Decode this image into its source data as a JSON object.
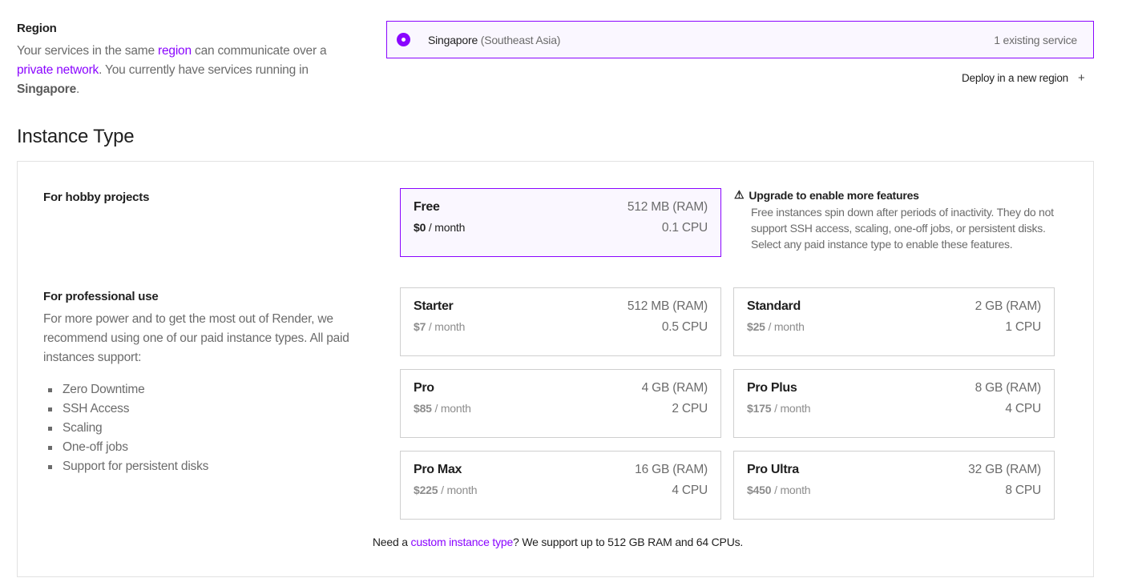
{
  "region": {
    "title": "Region",
    "desc_pre": "Your services in the same ",
    "desc_link1": "region",
    "desc_mid": " can communicate over a ",
    "desc_link2": "private network",
    "desc_post": ". You currently have services running in ",
    "desc_bold": "Singapore",
    "desc_end": ".",
    "option": {
      "name": "Singapore",
      "sub": "(Southeast Asia)",
      "count": "1 existing service"
    },
    "deploy_new_label": "Deploy in a new region"
  },
  "instance": {
    "title": "Instance Type",
    "hobby_title": "For hobby projects",
    "pro_title": "For professional use",
    "pro_desc": "For more power and to get the most out of Render, we recommend using one of our paid instance types. All paid instances support:",
    "features": [
      "Zero Downtime",
      "SSH Access",
      "Scaling",
      "One-off jobs",
      "Support for persistent disks"
    ],
    "per_month": "/ month",
    "free": {
      "name": "Free",
      "ram": "512 MB (RAM)",
      "price": "$0",
      "cpu": "0.1 CPU"
    },
    "warning": {
      "title": "Upgrade to enable more features",
      "body": "Free instances spin down after periods of inactivity. They do not support SSH access, scaling, one-off jobs, or persistent disks. Select any paid instance type to enable these features."
    },
    "plans": [
      {
        "name": "Starter",
        "ram": "512 MB (RAM)",
        "price": "$7",
        "cpu": "0.5 CPU"
      },
      {
        "name": "Standard",
        "ram": "2 GB (RAM)",
        "price": "$25",
        "cpu": "1 CPU"
      },
      {
        "name": "Pro",
        "ram": "4 GB (RAM)",
        "price": "$85",
        "cpu": "2 CPU"
      },
      {
        "name": "Pro Plus",
        "ram": "8 GB (RAM)",
        "price": "$175",
        "cpu": "4 CPU"
      },
      {
        "name": "Pro Max",
        "ram": "16 GB (RAM)",
        "price": "$225",
        "cpu": "4 CPU"
      },
      {
        "name": "Pro Ultra",
        "ram": "32 GB (RAM)",
        "price": "$450",
        "cpu": "8 CPU"
      }
    ],
    "custom_pre": "Need a ",
    "custom_link": "custom instance type",
    "custom_post": "? We support up to 512 GB RAM and 64 CPUs."
  },
  "colors": {
    "accent": "#8a05ff",
    "selected_bg": "#faf7ff"
  },
  "icons": {
    "radio": "radio-selected-icon",
    "plus": "plus-icon",
    "warning": "warning-icon"
  }
}
